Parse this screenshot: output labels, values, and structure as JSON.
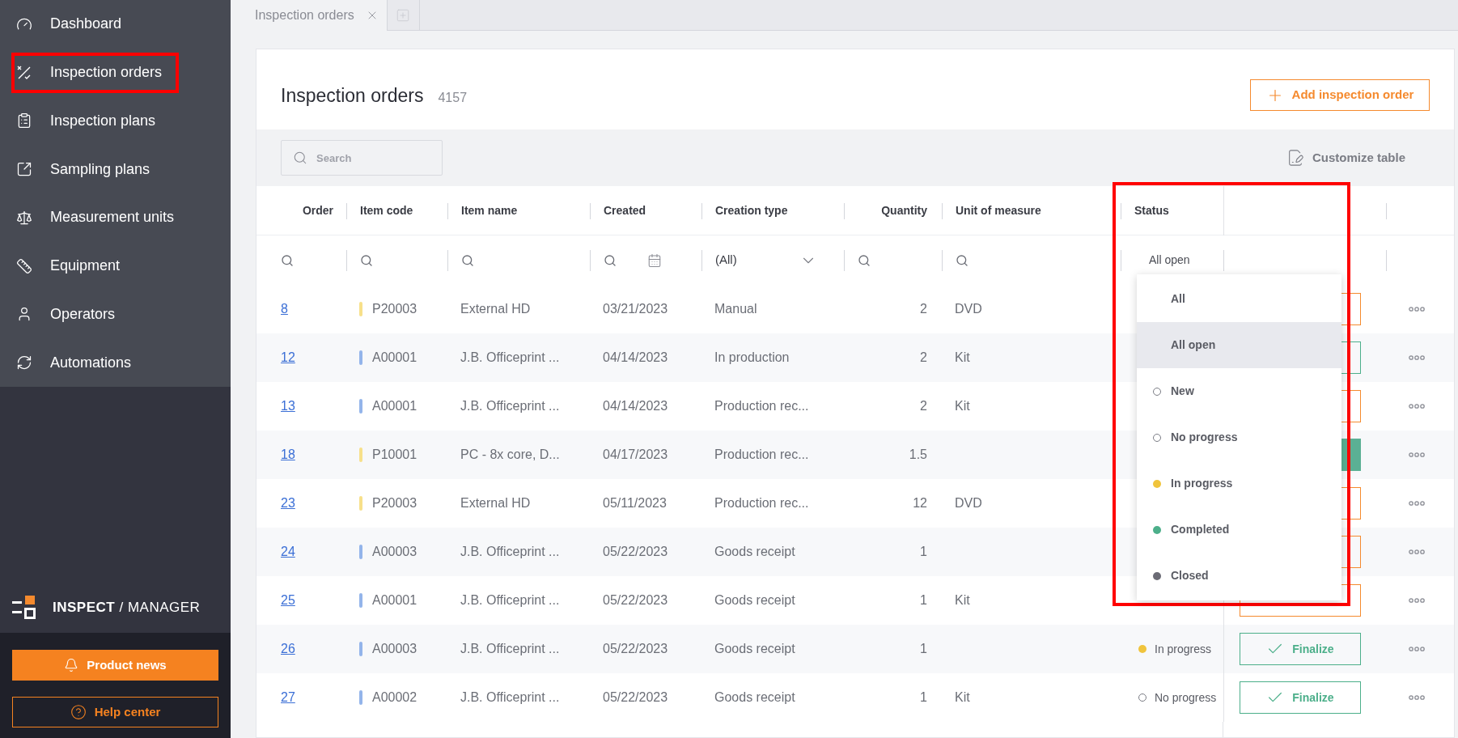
{
  "sidebar": {
    "items": [
      {
        "label": "Dashboard",
        "highlighted": false
      },
      {
        "label": "Inspection orders",
        "highlighted": true
      },
      {
        "label": "Inspection plans",
        "highlighted": false
      },
      {
        "label": "Sampling plans",
        "highlighted": false
      },
      {
        "label": "Measurement units",
        "highlighted": false
      },
      {
        "label": "Equipment",
        "highlighted": false
      },
      {
        "label": "Operators",
        "highlighted": false
      },
      {
        "label": "Automations",
        "highlighted": false
      }
    ],
    "brand": {
      "primary": "INSPECT",
      "separator": "/",
      "secondary": "MANAGER"
    },
    "buttons": [
      {
        "label": "Product news",
        "kind": "filled"
      },
      {
        "label": "Help center",
        "kind": "outline"
      }
    ]
  },
  "tabs": [
    {
      "label": "Inspection orders",
      "selected": true
    }
  ],
  "page": {
    "title": "Inspection orders",
    "count": "4157",
    "add_button": "Add inspection order",
    "search_placeholder": "Search",
    "customize": "Customize table"
  },
  "table": {
    "columns": [
      "Order",
      "Item code",
      "Item name",
      "Created",
      "Creation type",
      "Quantity",
      "Unit of measure",
      "Status"
    ],
    "filters": [
      {
        "kind": "search"
      },
      {
        "kind": "search"
      },
      {
        "kind": "search"
      },
      {
        "kind": "date"
      },
      {
        "kind": "select",
        "value": "(All)"
      },
      {
        "kind": "search"
      },
      {
        "kind": "search"
      },
      {
        "kind": "text",
        "value": "All open"
      }
    ],
    "rows": [
      {
        "order": "8",
        "item_code": "P20003",
        "color": "#f7e08a",
        "item_name": "External HD",
        "created": "03/21/2023",
        "creation_type": "Manual",
        "quantity": "2",
        "unit": "DVD",
        "action": {
          "kind": "release"
        }
      },
      {
        "order": "12",
        "item_code": "A00001",
        "color": "#93b4ea",
        "item_name": "J.B. Officeprint ...",
        "created": "04/14/2023",
        "creation_type": "In production",
        "quantity": "2",
        "unit": "Kit",
        "action": {
          "kind": "finalize"
        }
      },
      {
        "order": "13",
        "item_code": "A00001",
        "color": "#93b4ea",
        "item_name": "J.B. Officeprint ...",
        "created": "04/14/2023",
        "creation_type": "Production rec...",
        "quantity": "2",
        "unit": "Kit",
        "action": {
          "kind": "release"
        }
      },
      {
        "order": "18",
        "item_code": "P10001",
        "color": "#f7e08a",
        "item_name": "PC - 8x core, D...",
        "created": "04/17/2023",
        "creation_type": "Production rec...",
        "quantity": "1.5",
        "action": {
          "kind": "filled"
        }
      },
      {
        "order": "23",
        "item_code": "P20003",
        "color": "#f7e08a",
        "item_name": "External HD",
        "created": "05/11/2023",
        "creation_type": "Production rec...",
        "quantity": "12",
        "unit": "DVD",
        "action": {
          "kind": "release"
        }
      },
      {
        "order": "24",
        "item_code": "A00003",
        "color": "#93b4ea",
        "item_name": "J.B. Officeprint ...",
        "created": "05/22/2023",
        "creation_type": "Goods receipt",
        "quantity": "1",
        "action": {
          "kind": "release"
        }
      },
      {
        "order": "25",
        "item_code": "A00001",
        "color": "#93b4ea",
        "item_name": "J.B. Officeprint ...",
        "created": "05/22/2023",
        "creation_type": "Goods receipt",
        "quantity": "1",
        "unit": "Kit",
        "action": {
          "kind": "release"
        }
      },
      {
        "order": "26",
        "item_code": "A00003",
        "color": "#93b4ea",
        "item_name": "J.B. Officeprint ...",
        "created": "05/22/2023",
        "creation_type": "Goods receipt",
        "quantity": "1",
        "status": {
          "label": "In progress",
          "kind": "filled",
          "color": "#f0c43c"
        },
        "action": {
          "kind": "finalize",
          "label": "Finalize"
        }
      },
      {
        "order": "27",
        "item_code": "A00002",
        "color": "#93b4ea",
        "item_name": "J.B. Officeprint ...",
        "created": "05/22/2023",
        "creation_type": "Goods receipt",
        "quantity": "1",
        "unit": "Kit",
        "status": {
          "label": "No progress",
          "kind": "hollow"
        },
        "action": {
          "kind": "finalize",
          "label": "Finalize"
        }
      }
    ]
  },
  "status_dropdown": {
    "highlighted": true,
    "options": [
      {
        "label": "All",
        "kind": "none",
        "selected": false
      },
      {
        "label": "All open",
        "kind": "none",
        "selected": true
      },
      {
        "label": "New",
        "kind": "hollow",
        "selected": false
      },
      {
        "label": "No progress",
        "kind": "hollow",
        "selected": false
      },
      {
        "label": "In progress",
        "kind": "filled",
        "color": "#f0c43c",
        "selected": false
      },
      {
        "label": "Completed",
        "kind": "filled",
        "color": "#4caf8a",
        "selected": false
      },
      {
        "label": "Closed",
        "kind": "filled",
        "color": "#6b6b75",
        "selected": false
      }
    ]
  }
}
